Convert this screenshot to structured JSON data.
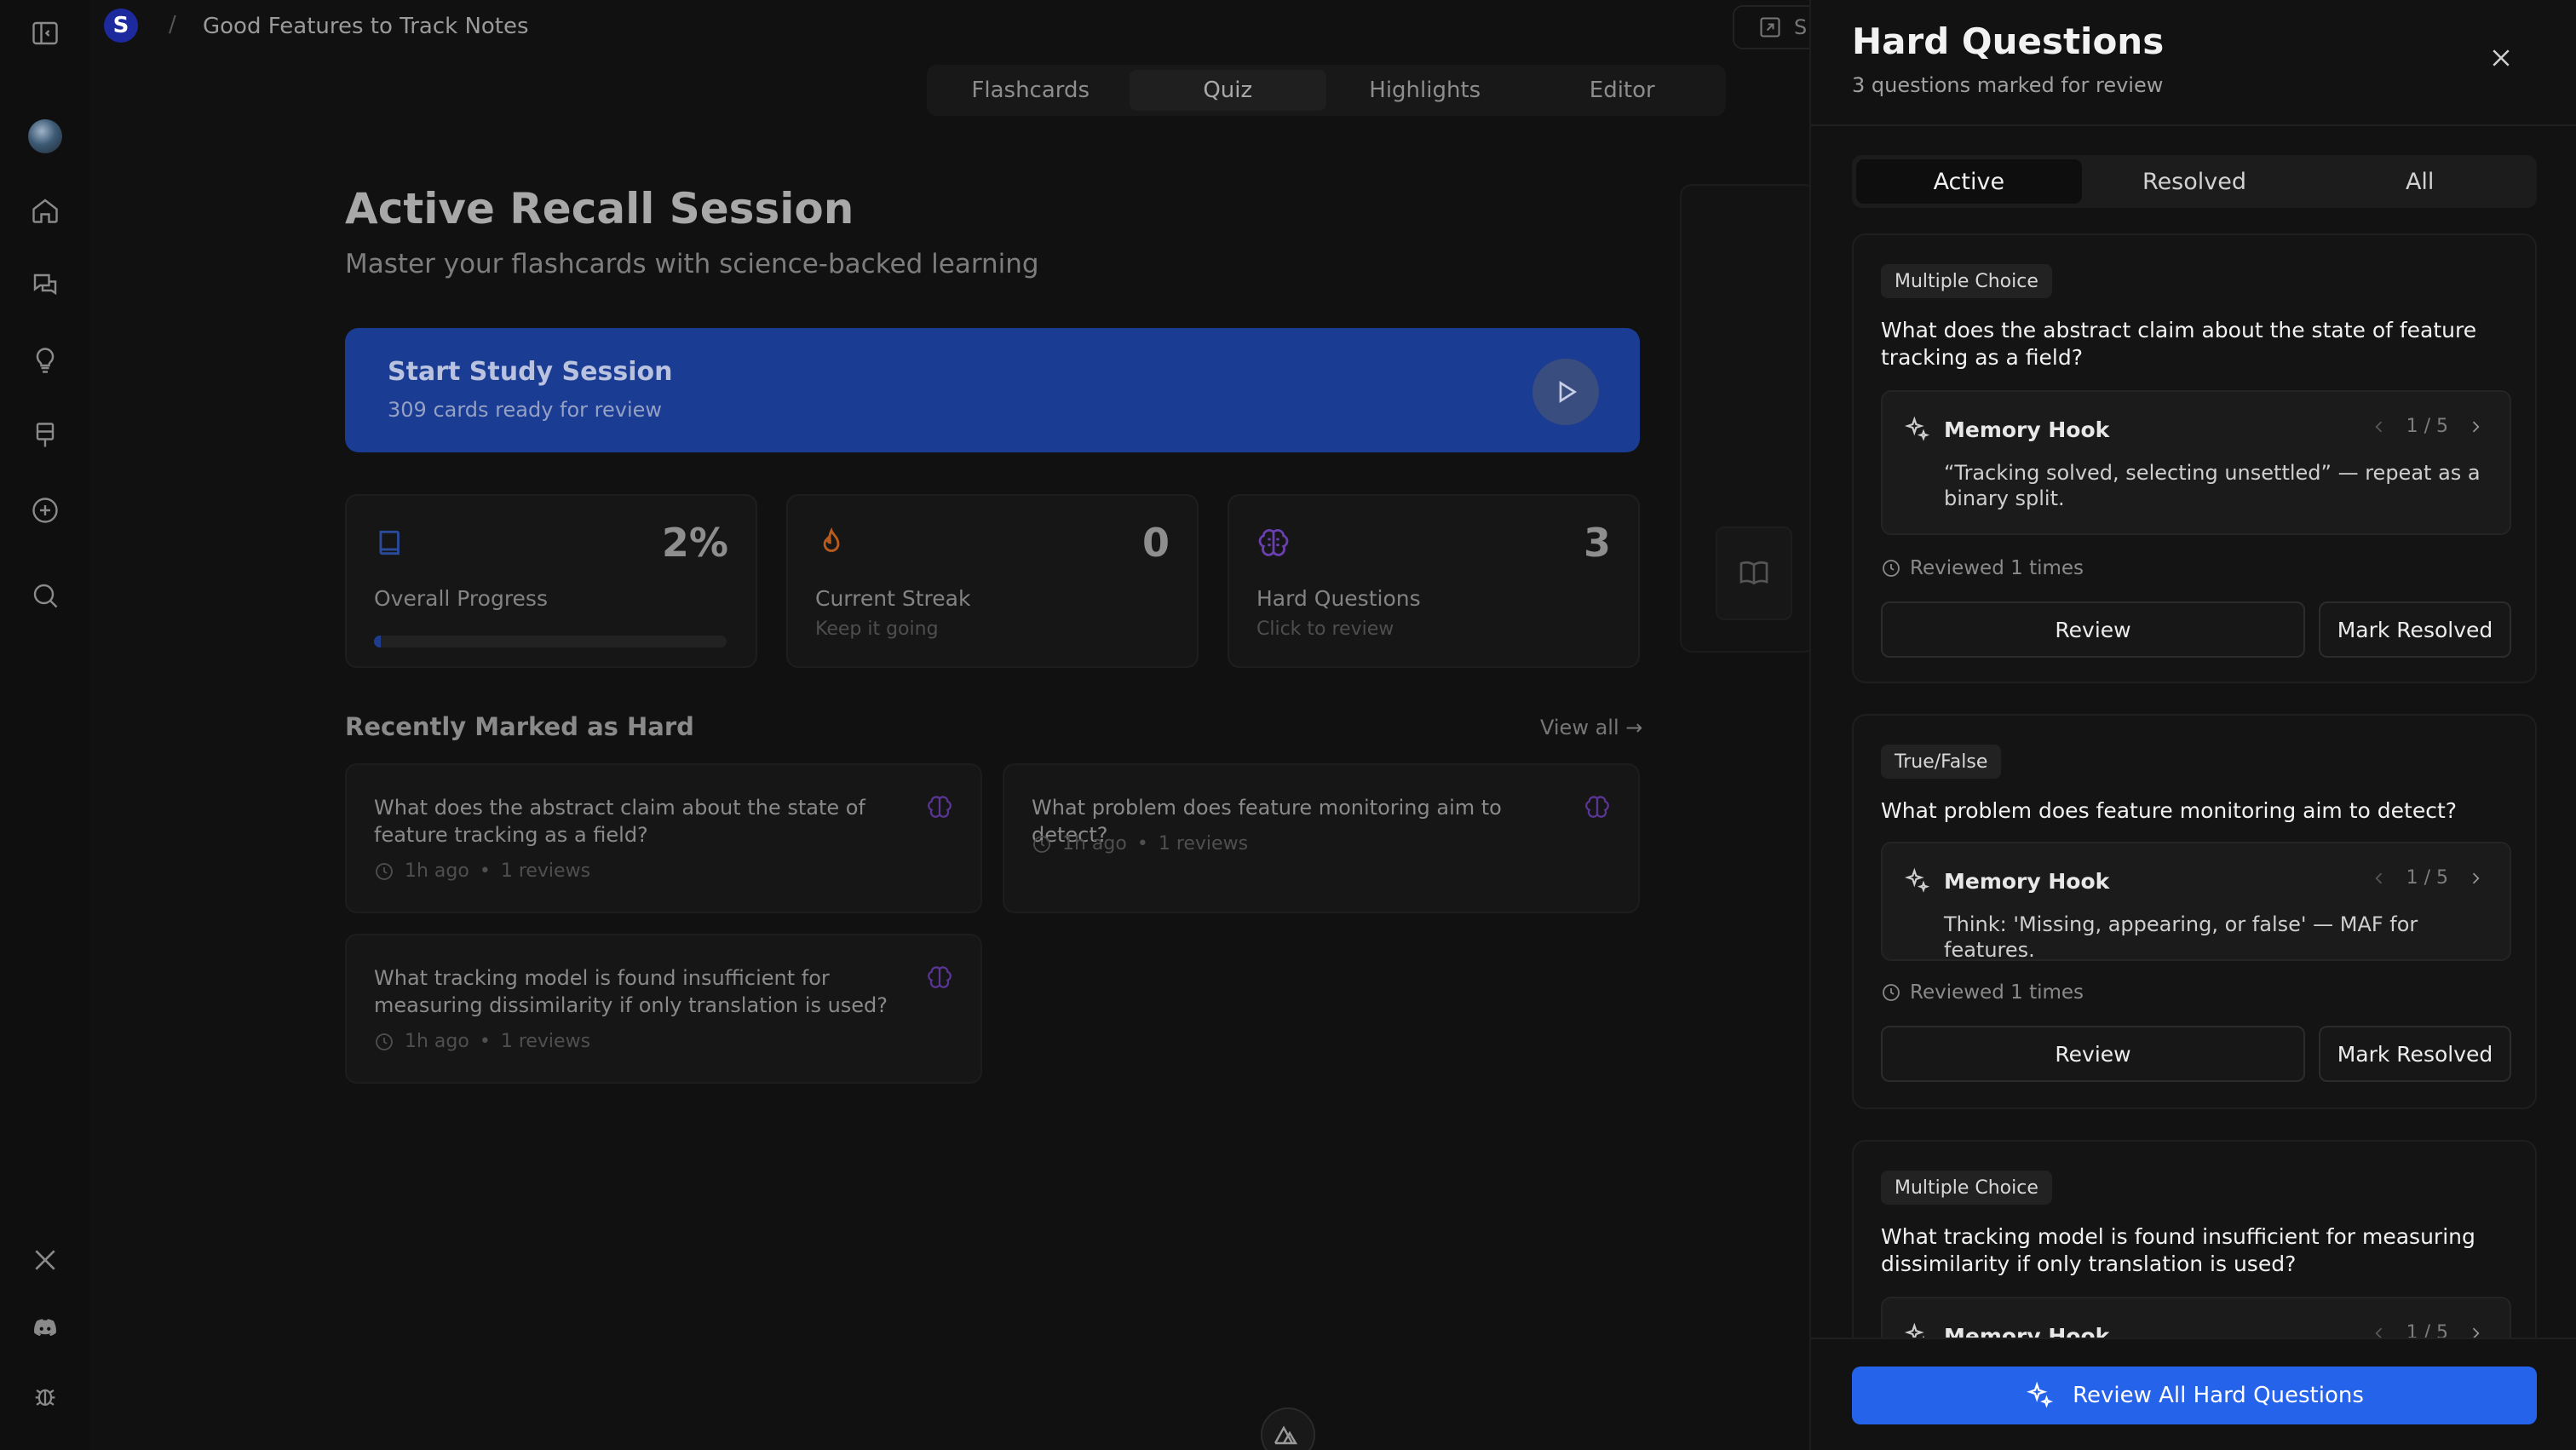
{
  "header": {
    "workspace_initial": "S",
    "separator": "/",
    "title": "Good Features to Track Notes",
    "share_label": "S"
  },
  "tabs": [
    {
      "label": "Flashcards",
      "active": false
    },
    {
      "label": "Quiz",
      "active": true
    },
    {
      "label": "Highlights",
      "active": false
    },
    {
      "label": "Editor",
      "active": false
    }
  ],
  "rail": {
    "icons": [
      "sidebar-toggle-icon",
      "avatar",
      "home-icon",
      "chat-icon",
      "lightbulb-icon",
      "flashcard-icon",
      "add-icon",
      "search-icon",
      "x-logo-icon",
      "discord-icon",
      "bug-icon"
    ]
  },
  "session": {
    "title": "Active Recall Session",
    "subtitle": "Master your flashcards with science-backed learning",
    "start": {
      "title": "Start Study Session",
      "subtitle": "309 cards ready for review"
    }
  },
  "stats": [
    {
      "value": "2%",
      "label": "Overall Progress",
      "hint": "",
      "progress": 0.02,
      "color": "#1e3d8f"
    },
    {
      "value": "0",
      "label": "Current Streak",
      "hint": "Keep it going",
      "color": "#b85b1c"
    },
    {
      "value": "3",
      "label": "Hard Questions",
      "hint": "Click to review",
      "color": "#6a3fb0"
    }
  ],
  "recent": {
    "title": "Recently Marked as Hard",
    "view_all": "View all →",
    "items": [
      {
        "question": "What does the abstract claim about the state of feature tracking as a field?",
        "time": "1h ago",
        "reviews": "1 reviews"
      },
      {
        "question": "What problem does feature monitoring aim to detect?",
        "time": "1h ago",
        "reviews": "1 reviews"
      },
      {
        "question": "What tracking model is found insufficient for measuring dissimilarity if only translation is used?",
        "time": "1h ago",
        "reviews": "1 reviews"
      }
    ],
    "meta_sep": "•"
  },
  "panel": {
    "title": "Hard Questions",
    "subtitle": "3 questions marked for review",
    "segments": [
      {
        "label": "Active",
        "active": true
      },
      {
        "label": "Resolved",
        "active": false
      },
      {
        "label": "All",
        "active": false
      }
    ],
    "hook_label": "Memory Hook",
    "cards": [
      {
        "type": "Multiple Choice",
        "question": "What does the abstract claim about the state of feature tracking as a field?",
        "hook_page": "1 / 5",
        "hook_text": "“Tracking solved, selecting unsettled” — repeat as a binary split.",
        "reviewed": "Reviewed 1 times",
        "review_label": "Review",
        "resolve_label": "Mark Resolved"
      },
      {
        "type": "True/False",
        "question": "What problem does feature monitoring aim to detect?",
        "hook_page": "1 / 5",
        "hook_text": "Think: 'Missing, appearing, or false' — MAF for features.",
        "reviewed": "Reviewed 1 times",
        "review_label": "Review",
        "resolve_label": "Mark Resolved"
      },
      {
        "type": "Multiple Choice",
        "question": "What tracking model is found insufficient for measuring dissimilarity if only translation is used?",
        "hook_page": "1 / 5"
      }
    ],
    "review_all": "Review All Hard Questions"
  },
  "colors": {
    "accent": "#2563eb",
    "study_bg": "#1b3c93"
  }
}
